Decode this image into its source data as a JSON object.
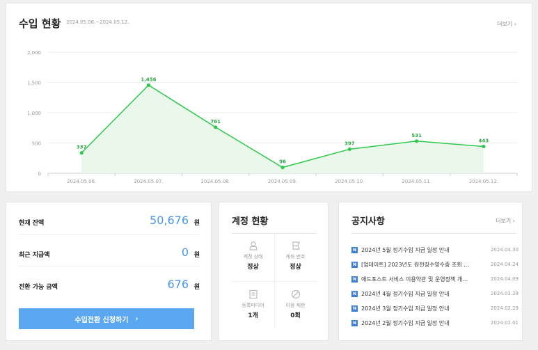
{
  "earnings": {
    "title": "수입 현황",
    "range": "2024.05.06.~2024.05.12.",
    "more": "더보기 ›"
  },
  "chart_data": {
    "type": "area",
    "x": [
      "2024.05.06.",
      "2024.05.07.",
      "2024.05.08.",
      "2024.05.09.",
      "2024.05.10.",
      "2024.05.11.",
      "2024.05.12."
    ],
    "values": [
      337,
      1456,
      761,
      96,
      397,
      531,
      443
    ],
    "data_labels": [
      "337",
      "1,456",
      "761",
      "96",
      "397",
      "531",
      "443"
    ],
    "y_ticks": [
      "0",
      "500",
      "1,000",
      "1,500",
      "2,000"
    ],
    "ylim": [
      0,
      2000
    ],
    "grid": true,
    "colors": {
      "line": "#2ec84c",
      "fill": "#eaf8ec"
    }
  },
  "balance": {
    "rows": [
      {
        "label": "현재 잔액",
        "value": "50,676",
        "unit": "원"
      },
      {
        "label": "최근 지급액",
        "value": "0",
        "unit": "원"
      },
      {
        "label": "전환 가능 금액",
        "value": "676",
        "unit": "원"
      }
    ],
    "button": "수입전환 신청하기",
    "button_arrow": "›",
    "accent": "#5ba7f1"
  },
  "account": {
    "title": "계정 현황",
    "cells": [
      {
        "label": "계정 상태",
        "value": "정상",
        "icon": "user-icon"
      },
      {
        "label": "계좌 번호",
        "value": "정상",
        "icon": "bank-card-icon"
      },
      {
        "label": "등록미디어",
        "value": "1개",
        "icon": "document-icon"
      },
      {
        "label": "이용 제한",
        "value": "0회",
        "icon": "block-icon"
      }
    ]
  },
  "notice": {
    "title": "공지사항",
    "more": "더보기 ›",
    "badge": "N",
    "items": [
      {
        "text": "2024년 5월 정기수입 지급 일정 안내",
        "date": "2024.04.30"
      },
      {
        "text": "[업데이트] 2023년도 원천징수영수증 조회 …",
        "date": "2024.04.24"
      },
      {
        "text": "애드포스트 서비스 이용약관 및 운영정책 개…",
        "date": "2024.04.09"
      },
      {
        "text": "2024년 4월 정기수입 지급 일정 안내",
        "date": "2024.03.29"
      },
      {
        "text": "2024년 3월 정기수입 지급 일정 안내",
        "date": "2024.02.29"
      },
      {
        "text": "2024년 2월 정기수입 지급 일정 안내",
        "date": "2024.02.01"
      }
    ]
  }
}
